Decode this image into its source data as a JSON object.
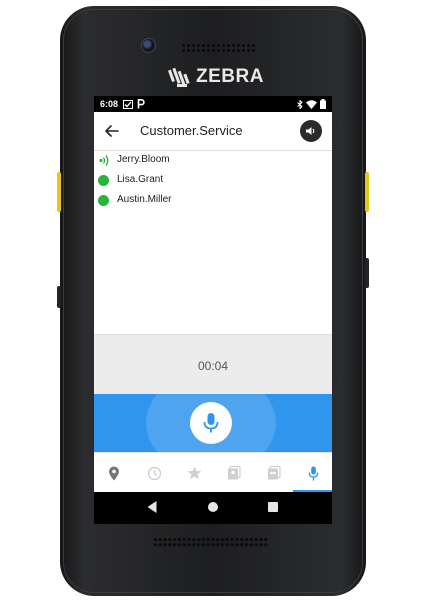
{
  "device": {
    "brand": "ZEBRA"
  },
  "status_bar": {
    "time": "6:08"
  },
  "app_bar": {
    "title": "Customer.Service",
    "back_icon": "arrow-left-icon",
    "volume_icon": "volume-icon"
  },
  "members": [
    {
      "name": "Jerry.Bloom",
      "status": "speaking"
    },
    {
      "name": "Lisa.Grant",
      "status": "online"
    },
    {
      "name": "Austin.Miller",
      "status": "online"
    }
  ],
  "call": {
    "timer": "00:04"
  },
  "colors": {
    "accent": "#2f95ed",
    "online": "#27b43c"
  },
  "bottom_nav": {
    "items": [
      {
        "icon": "location-pin-icon"
      },
      {
        "icon": "history-clock-icon"
      },
      {
        "icon": "star-icon"
      },
      {
        "icon": "contacts-icon"
      },
      {
        "icon": "groups-icon"
      },
      {
        "icon": "microphone-icon",
        "active": true
      }
    ]
  }
}
